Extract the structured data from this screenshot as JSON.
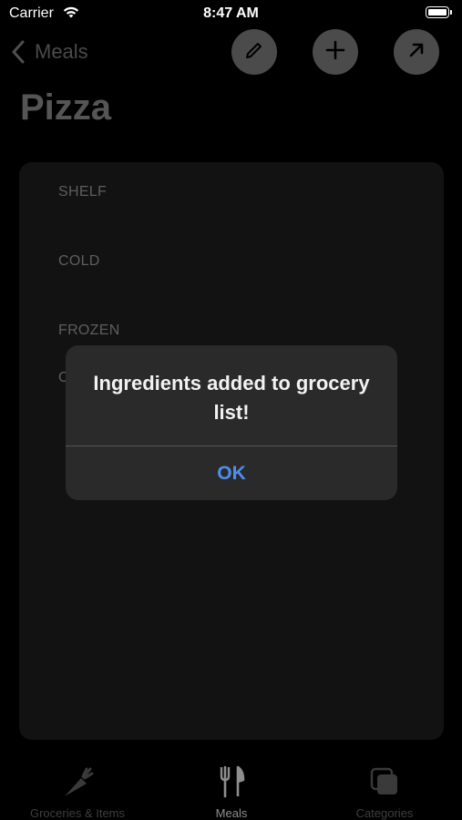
{
  "status_bar": {
    "carrier": "Carrier",
    "time": "8:47 AM"
  },
  "nav": {
    "back_label": "Meals",
    "buttons": [
      "pencil-icon",
      "plus-icon",
      "arrow-up-right-icon"
    ]
  },
  "title": "Pizza",
  "sections": [
    "SHELF",
    "COLD",
    "FROZEN",
    "O"
  ],
  "alert": {
    "message": "Ingredients added to grocery list!",
    "ok_label": "OK"
  },
  "tab_bar": {
    "tabs": [
      {
        "label": "Groceries & Items",
        "icon": "carrot-icon"
      },
      {
        "label": "Meals",
        "icon": "fork-knife-icon",
        "selected": true
      },
      {
        "label": "Categories",
        "icon": "stacked-squares-icon"
      }
    ]
  },
  "colors": {
    "accent": "#4e8ef0",
    "background": "#000000",
    "alert_bg": "#2a2a2a"
  }
}
